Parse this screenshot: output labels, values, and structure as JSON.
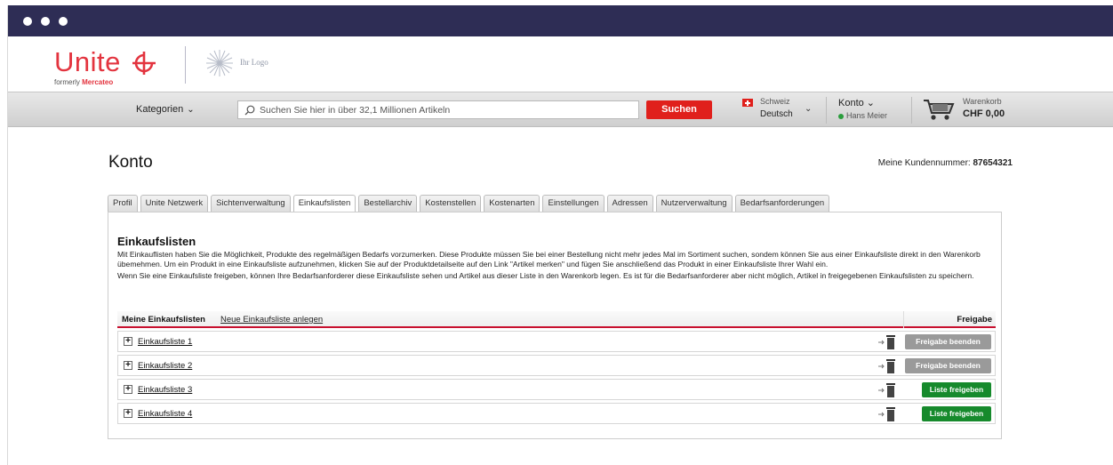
{
  "brand": {
    "name": "Unite",
    "formerly_prefix": "formerly",
    "formerly_name": "Mercateo",
    "placeholder_logo": "Ihr Logo"
  },
  "nav": {
    "categories_label": "Kategorien",
    "search_placeholder": "Suchen Sie hier in über 32,1 Millionen Artikeln",
    "search_button": "Suchen",
    "region_country": "Schweiz",
    "region_language": "Deutsch",
    "account_label": "Konto",
    "account_user": "Hans Meier",
    "cart_label": "Warenkorb",
    "cart_amount": "CHF 0,00"
  },
  "page": {
    "title": "Konto",
    "customer_number_label": "Meine Kundennummer:",
    "customer_number": "87654321"
  },
  "tabs": [
    {
      "label": "Profil",
      "active": false
    },
    {
      "label": "Unite Netzwerk",
      "active": false
    },
    {
      "label": "Sichtenverwaltung",
      "active": false
    },
    {
      "label": "Einkaufslisten",
      "active": true
    },
    {
      "label": "Bestellarchiv",
      "active": false
    },
    {
      "label": "Kostenstellen",
      "active": false
    },
    {
      "label": "Kostenarten",
      "active": false
    },
    {
      "label": "Einstellungen",
      "active": false
    },
    {
      "label": "Adressen",
      "active": false
    },
    {
      "label": "Nutzerverwaltung",
      "active": false
    },
    {
      "label": "Bedarfsanforderungen",
      "active": false
    }
  ],
  "section": {
    "heading": "Einkaufslisten",
    "paragraph1": "Mit Einkauflisten haben Sie die Möglichkeit, Produkte des regelmäßigen Bedarfs vorzumerken. Diese Produkte müssen Sie bei einer Bestellung nicht mehr jedes Mal im Sortiment suchen, sondem können Sie aus einer Einkaufsliste direkt in den Warenkorb übemehmen. Um ein Produkt in eine Einkaufsliste aufzunehmen, klicken Sie auf der Produktdetailseite auf den Link \"Artikel merken\" und fügen Sie anschließend das Produkt in einer Einkaufsliste Ihrer Wahl ein.",
    "paragraph2": "Wenn Sie eine Einkaufsliste freigeben, können Ihre Bedarfsanforderer diese Einkaufsliste sehen und Artikel aus dieser Liste in den Warenkorb legen. Es ist für die Bedarfsanforderer aber nicht möglich, Artikel in freigegebenen Einkaufslisten zu speichern.",
    "list_header": "Meine Einkaufslisten",
    "new_list_link": "Neue Einkaufsliste anlegen",
    "share_header": "Freigabe"
  },
  "lists": [
    {
      "name": "Einkaufsliste 1",
      "action": "Freigabe beenden",
      "shared": true
    },
    {
      "name": "Einkaufsliste 2",
      "action": "Freigabe beenden",
      "shared": true
    },
    {
      "name": "Einkaufsliste 3",
      "action": "Liste freigeben",
      "shared": false
    },
    {
      "name": "Einkaufsliste 4",
      "action": "Liste freigeben",
      "shared": false
    }
  ],
  "colors": {
    "titlebar": "#2e2d55",
    "brand_red": "#e3343f",
    "search_button": "#e0201c",
    "share_active": "#168a2c",
    "share_end": "#9a9a9a",
    "header_rule": "#c8102e"
  },
  "icons": {
    "expand": "plus-box-icon",
    "move": "arrow-icon",
    "delete": "trash-icon",
    "cart": "shopping-cart-icon",
    "search": "magnifier-icon"
  }
}
